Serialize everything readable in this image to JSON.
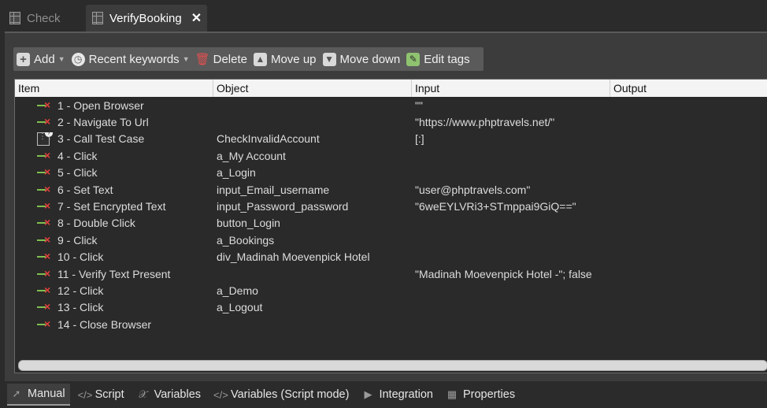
{
  "editor_tabs": [
    {
      "label": "Check",
      "icon": "table-icon",
      "active": false
    },
    {
      "label": "VerifyBooking",
      "icon": "table-icon",
      "active": true
    }
  ],
  "close_icon": "close-icon",
  "toolbar": {
    "add": "Add",
    "recent_keywords": "Recent keywords",
    "delete": "Delete",
    "move_up": "Move up",
    "move_down": "Move down",
    "edit_tags": "Edit tags"
  },
  "table": {
    "headers": {
      "item": "Item",
      "object": "Object",
      "input": "Input",
      "output": "Output"
    },
    "rows": [
      {
        "item": "1 - Open Browser",
        "object": "",
        "input": "\"\"",
        "output": "",
        "icon": "keyword-icon"
      },
      {
        "item": "2 - Navigate To Url",
        "object": "",
        "input": "\"https://www.phptravels.net/\"",
        "output": "",
        "icon": "keyword-icon"
      },
      {
        "item": "3 - Call Test Case",
        "object": "CheckInvalidAccount",
        "input": "[:]",
        "output": "",
        "icon": "test-case-icon"
      },
      {
        "item": "4 - Click",
        "object": "a_My Account",
        "input": "",
        "output": "",
        "icon": "keyword-icon"
      },
      {
        "item": "5 - Click",
        "object": "a_Login",
        "input": "",
        "output": "",
        "icon": "keyword-icon"
      },
      {
        "item": "6 - Set Text",
        "object": "input_Email_username",
        "input": "\"user@phptravels.com\"",
        "output": "",
        "icon": "keyword-icon"
      },
      {
        "item": "7 - Set Encrypted Text",
        "object": "input_Password_password",
        "input": "\"6weEYLVRi3+STmppai9GiQ==\"",
        "output": "",
        "icon": "keyword-icon"
      },
      {
        "item": "8 - Double Click",
        "object": "button_Login",
        "input": "",
        "output": "",
        "icon": "keyword-icon"
      },
      {
        "item": "9 - Click",
        "object": "a_Bookings",
        "input": "",
        "output": "",
        "icon": "keyword-icon"
      },
      {
        "item": "10 - Click",
        "object": "div_Madinah Moevenpick Hotel",
        "input": "",
        "output": "",
        "icon": "keyword-icon"
      },
      {
        "item": "11 - Verify Text Present",
        "object": "",
        "input": "\"Madinah Moevenpick Hotel -\"; false",
        "output": "",
        "icon": "keyword-icon"
      },
      {
        "item": "12 - Click",
        "object": "a_Demo",
        "input": "",
        "output": "",
        "icon": "keyword-icon"
      },
      {
        "item": "13 - Click",
        "object": "a_Logout",
        "input": "",
        "output": "",
        "icon": "keyword-icon"
      },
      {
        "item": "14 - Close Browser",
        "object": "",
        "input": "",
        "output": "",
        "icon": "keyword-icon"
      }
    ]
  },
  "bottom_tabs": [
    {
      "label": "Manual",
      "icon": "cursor-icon",
      "active": true
    },
    {
      "label": "Script",
      "icon": "code-icon",
      "active": false
    },
    {
      "label": "Variables",
      "icon": "variable-icon",
      "active": false
    },
    {
      "label": "Variables (Script mode)",
      "icon": "code-icon",
      "active": false
    },
    {
      "label": "Integration",
      "icon": "integration-icon",
      "active": false
    },
    {
      "label": "Properties",
      "icon": "table-icon",
      "active": false
    }
  ]
}
